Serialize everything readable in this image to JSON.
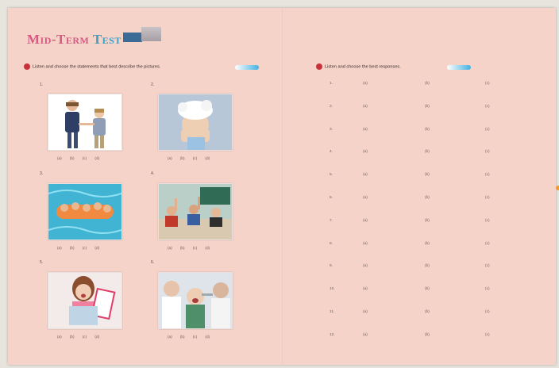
{
  "test_title": {
    "part1": "Mid-Term",
    "part2": "Test",
    "badge": ""
  },
  "section_left": {
    "number": "",
    "instruction": "Listen and choose the statements that best describe the pictures."
  },
  "section_right": {
    "number": "",
    "instruction": "Listen and choose the best responses."
  },
  "pictures": [
    {
      "label": "1.",
      "options": "(a) (b) (c) (d)"
    },
    {
      "label": "2.",
      "options": "(a) (b) (c) (d)"
    },
    {
      "label": "3.",
      "options": "(a) (b) (c) (d)"
    },
    {
      "label": "4.",
      "options": "(a) (b) (c) (d)"
    },
    {
      "label": "5.",
      "options": "(a) (b) (c) (d)"
    },
    {
      "label": "6.",
      "options": "(a) (b) (c) (d)"
    }
  ],
  "responses": [
    {
      "num": "1.",
      "a": "(a)",
      "b": "(b)",
      "c": "(c)"
    },
    {
      "num": "2.",
      "a": "(a)",
      "b": "(b)",
      "c": "(c)"
    },
    {
      "num": "3.",
      "a": "(a)",
      "b": "(b)",
      "c": "(c)"
    },
    {
      "num": "4.",
      "a": "(a)",
      "b": "(b)",
      "c": "(c)"
    },
    {
      "num": "5.",
      "a": "(a)",
      "b": "(b)",
      "c": "(c)"
    },
    {
      "num": "6.",
      "a": "(a)",
      "b": "(b)",
      "c": "(c)"
    },
    {
      "num": "7.",
      "a": "(a)",
      "b": "(b)",
      "c": "(c)"
    },
    {
      "num": "8.",
      "a": "(a)",
      "b": "(b)",
      "c": "(c)"
    },
    {
      "num": "9.",
      "a": "(a)",
      "b": "(b)",
      "c": "(c)"
    },
    {
      "num": "10.",
      "a": "(a)",
      "b": "(b)",
      "c": "(c)"
    },
    {
      "num": "11.",
      "a": "(a)",
      "b": "(b)",
      "c": "(c)"
    },
    {
      "num": "12.",
      "a": "(a)",
      "b": "(b)",
      "c": "(c)"
    }
  ],
  "page_numbers": {
    "left": "",
    "right": ""
  },
  "colors": {
    "page": "#f6d3c8",
    "title_pink": "#d65a82",
    "title_blue": "#3e9ec1",
    "accent_red": "#c8323b",
    "audio_blue": "#43b1e3"
  },
  "icons": {
    "audio": "speaker-audio-icon",
    "section": "number-circle-icon"
  }
}
